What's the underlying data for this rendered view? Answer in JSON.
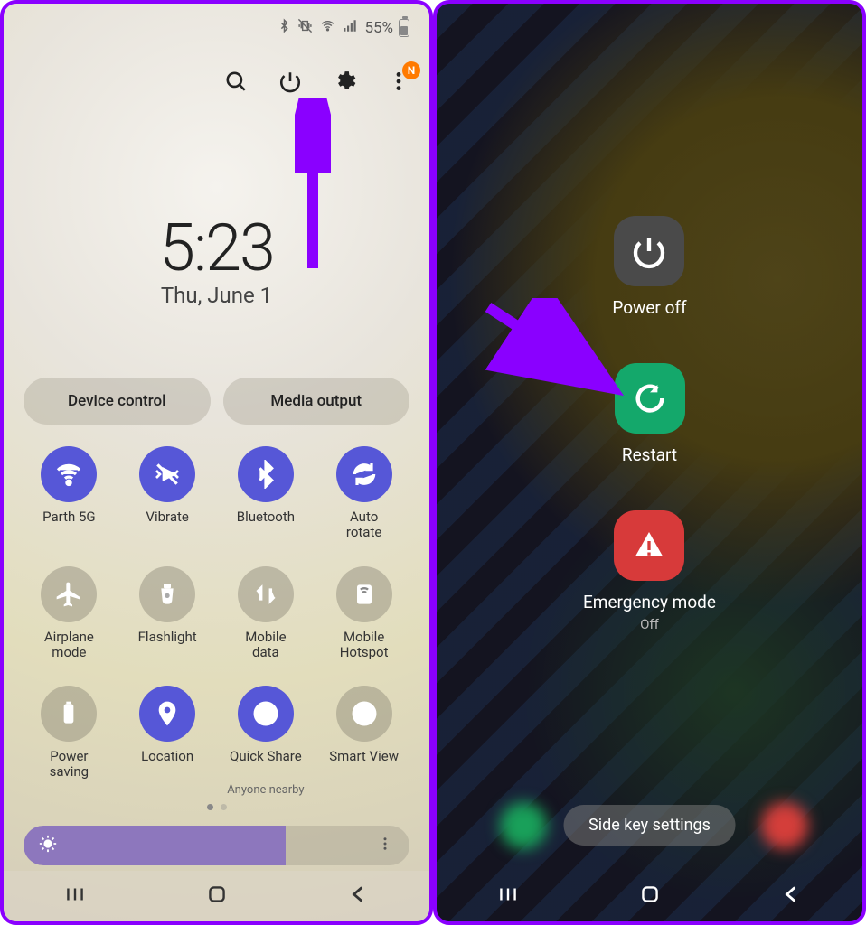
{
  "status": {
    "battery_pct": "55%",
    "icons": [
      "bluetooth",
      "vibrate",
      "wifi",
      "signal"
    ]
  },
  "top_actions": {
    "search": "Search",
    "power": "Power",
    "settings": "Settings",
    "more": "More",
    "badge": "N"
  },
  "clock": {
    "time": "5:23",
    "date": "Thu, June 1"
  },
  "pills": {
    "device_control": "Device control",
    "media_output": "Media output"
  },
  "quick_settings": [
    {
      "id": "wifi",
      "label": "Parth 5G",
      "on": true
    },
    {
      "id": "vibrate",
      "label": "Vibrate",
      "on": true
    },
    {
      "id": "bt",
      "label": "Bluetooth",
      "on": true
    },
    {
      "id": "rotate",
      "label": "Auto\nrotate",
      "on": true
    },
    {
      "id": "airplane",
      "label": "Airplane\nmode",
      "on": false
    },
    {
      "id": "flash",
      "label": "Flashlight",
      "on": false
    },
    {
      "id": "mdata",
      "label": "Mobile\ndata",
      "on": false
    },
    {
      "id": "hotspot",
      "label": "Mobile\nHotspot",
      "on": false
    },
    {
      "id": "psave",
      "label": "Power\nsaving",
      "on": false
    },
    {
      "id": "location",
      "label": "Location",
      "on": true
    },
    {
      "id": "qshare",
      "label": "Quick Share",
      "sub": "Anyone nearby",
      "on": true
    },
    {
      "id": "sview",
      "label": "Smart View",
      "on": false
    }
  ],
  "power_menu": {
    "power_off": "Power off",
    "restart": "Restart",
    "emergency": "Emergency mode",
    "emergency_state": "Off",
    "side_key": "Side key settings"
  },
  "annotations": {
    "arrow_left_target": "power-button",
    "arrow_right_target": "restart-button"
  }
}
